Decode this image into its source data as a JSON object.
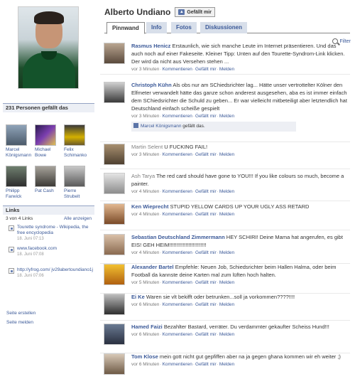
{
  "profile": {
    "name": "Alberto Undiano",
    "like_button": "Gefällt mir"
  },
  "tabs": [
    {
      "label": "Pinnwand",
      "active": true
    },
    {
      "label": "Info",
      "active": false
    },
    {
      "label": "Fotos",
      "active": false
    },
    {
      "label": "Diskussionen",
      "active": false
    }
  ],
  "filter_label": "Filter",
  "likes_box": {
    "header": "231 Personen gefällt das",
    "friends": [
      {
        "name": "Marcel Königsmann"
      },
      {
        "name": "Michael Bowe"
      },
      {
        "name": "Felix Schimanko"
      },
      {
        "name": "Philipp Farwick"
      },
      {
        "name": "Pat Cash"
      },
      {
        "name": "Pierre Strubelt"
      }
    ]
  },
  "links_box": {
    "header": "Links",
    "count": "3 von 4 Links",
    "show_all": "Alle anzeigen",
    "items": [
      {
        "title": "Tourette syndrome - Wikipedia, the free encyclopedia",
        "date": "18. Juni 07:13"
      },
      {
        "title": "www.facebook.com",
        "date": "18. Juni 07:08"
      },
      {
        "title": "http://yfrog.com/ jv29abertoundiano1j",
        "date": "18. Juni 07:06"
      }
    ]
  },
  "bottom_links": {
    "create": "Seite erstellen",
    "report": "Seite melden"
  },
  "meta_labels": {
    "comment": "Kommentieren",
    "like": "Gefällt mir",
    "report": "Melden",
    "sep": "·"
  },
  "posts": [
    {
      "author": "Rasmus Henicz",
      "text": "Erstaunlich, wie sich manche Leute im Internet präsentieren. Und das auch noch auf einer Fakeseite. Kleiner Tipp: Unten auf den Tourette-Syndrom-Link klicken. Der wird da nicht aus Versehen stehen ...",
      "time": "vor 3 Minuten"
    },
    {
      "author": "Christoph Kühn",
      "text": "Als obs nur am SChiedsrichter lag... Hätte unser vertrottelter Kölner den Elfmeter verwandelt hätte das ganze schon anderest ausgesehen, aba es ist immer einfach dem SChiedsrichter die Schuld zu geben... Er war vielleicht mitbeteiligt aber letztendlich hat Deutschland einfach scheiße gespielt",
      "time": "vor 3 Minuten",
      "liked_by": "Marcel Königsmann",
      "liked_suffix": "gefällt das."
    },
    {
      "author": "Martin Selent",
      "text": "U FUCKING FAIL!",
      "time": "vor 3 Minuten",
      "plain": true
    },
    {
      "author": "Ash Tarya",
      "text": "The red card should have gone to YOU!!! If you like colours so much, become a painter.",
      "time": "vor 4 Minuten",
      "plain": true
    },
    {
      "author": "Ken Wieprecht",
      "text": "STUPID YELLOW CARDS UP YOUR UGLY ASS RETARD",
      "time": "vor 4 Minuten"
    },
    {
      "author": "Sebastian Deutschland Zimmermann",
      "text": "HEY SCHIRI! Deine Mama hat angerufen, es gibt EIS! GEH HEIM!!!!!!!!!!!!!!!!!!!!!!!!!",
      "time": "vor 4 Minuten"
    },
    {
      "author": "Alexander Bartel",
      "text": "Empfehle: Neuen Job, Schiedsrichter beim Hallen Halma, oder beim Football da kannste deine Karten mal zum lüften hoch halten.",
      "time": "vor 5 Minuten"
    },
    {
      "author": "Ei Ke",
      "text": "Waren sie vlt bekifft oder betrunken...soll ja vorkommen????!!!!",
      "time": "vor 6 Minuten"
    },
    {
      "author": "Hamed Faizi",
      "text": "Bezahlter Bastard, verräter. Du verdammter gekaufter Scheiss Hund!!!",
      "time": "vor 6 Minuten"
    },
    {
      "author": "Tom Klose",
      "text": "mein gott nicht gut gepfiffen aber na ja gegen ghana kommen wir eh weiter ;)",
      "time": "vor 6 Minuten"
    }
  ]
}
